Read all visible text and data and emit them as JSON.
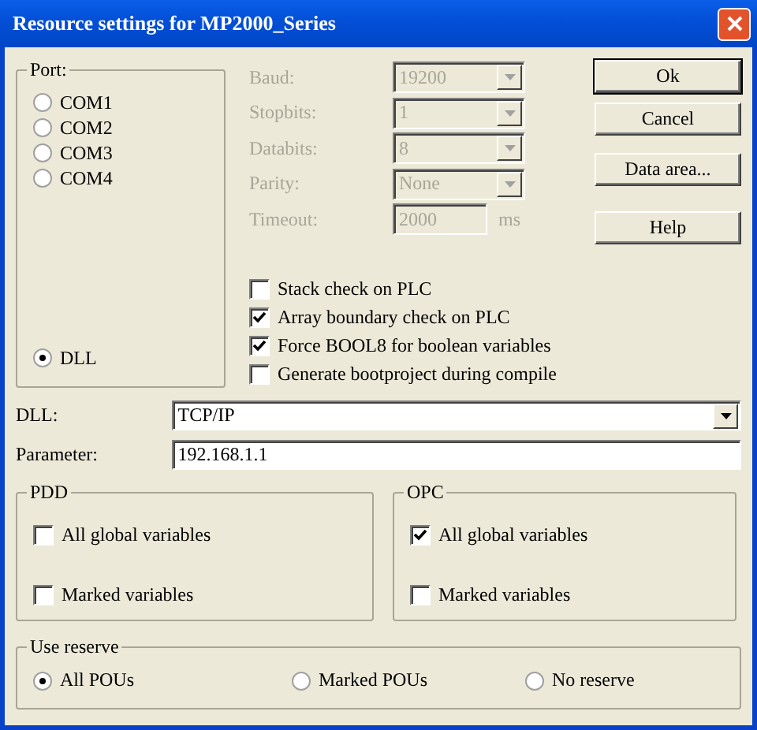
{
  "window": {
    "title": "Resource settings for MP2000_Series"
  },
  "port": {
    "label": "Port:",
    "options": [
      {
        "label": "COM1",
        "selected": false
      },
      {
        "label": "COM2",
        "selected": false
      },
      {
        "label": "COM3",
        "selected": false
      },
      {
        "label": "COM4",
        "selected": false
      },
      {
        "label": "DLL",
        "selected": true
      }
    ]
  },
  "serial_settings": [
    {
      "label": "Baud:",
      "kind": "dropdown",
      "value": "19200",
      "disabled": true
    },
    {
      "label": "Stopbits:",
      "kind": "dropdown",
      "value": "1",
      "disabled": true
    },
    {
      "label": "Databits:",
      "kind": "dropdown",
      "value": "8",
      "disabled": true
    },
    {
      "label": "Parity:",
      "kind": "dropdown",
      "value": "None",
      "disabled": true
    },
    {
      "label": "Timeout:",
      "kind": "field",
      "value": "2000",
      "unit": "ms",
      "disabled": true
    }
  ],
  "options": [
    {
      "label": "Stack check on PLC",
      "checked": false
    },
    {
      "label": "Array boundary check on PLC",
      "checked": true
    },
    {
      "label": "Force BOOL8 for boolean variables",
      "checked": true
    },
    {
      "label": "Generate bootproject during compile",
      "checked": false
    }
  ],
  "buttons": [
    {
      "label": "Ok",
      "default": true
    },
    {
      "label": "Cancel",
      "default": false
    },
    {
      "label": "Data area...",
      "default": false
    },
    {
      "label": "Help",
      "default": false
    }
  ],
  "dll": {
    "label": "DLL:",
    "value": "TCP/IP"
  },
  "parameter": {
    "label": "Parameter:",
    "value": "192.168.1.1"
  },
  "pdd": {
    "label": "PDD",
    "options": [
      {
        "label": "All global variables",
        "checked": false
      },
      {
        "label": "Marked variables",
        "checked": false
      }
    ]
  },
  "opc": {
    "label": "OPC",
    "options": [
      {
        "label": "All global variables",
        "checked": true
      },
      {
        "label": "Marked variables",
        "checked": false
      }
    ]
  },
  "use_reserve": {
    "label": "Use reserve",
    "options": [
      {
        "label": "All POUs",
        "selected": true
      },
      {
        "label": "Marked POUs",
        "selected": false
      },
      {
        "label": "No reserve",
        "selected": false
      }
    ]
  }
}
